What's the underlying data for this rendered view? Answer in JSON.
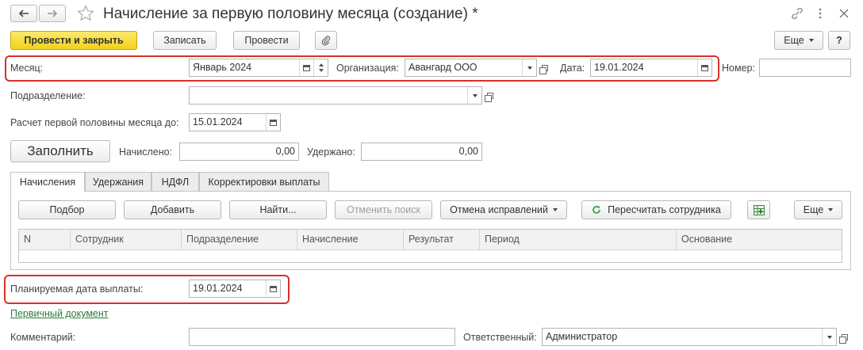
{
  "window": {
    "title": "Начисление за первую половину месяца (создание) *"
  },
  "toolbar": {
    "post_close": "Провести и закрыть",
    "save": "Записать",
    "post": "Провести",
    "more": "Еще",
    "help": "?"
  },
  "header": {
    "month_label": "Месяц:",
    "month_value": "Январь 2024",
    "org_label": "Организация:",
    "org_value": "Авангард ООО",
    "date_label": "Дата:",
    "date_value": "19.01.2024",
    "number_label": "Номер:",
    "number_value": ""
  },
  "division": {
    "label": "Подразделение:",
    "value": ""
  },
  "calc_until": {
    "label": "Расчет первой половины месяца до:",
    "value": "15.01.2024"
  },
  "fill": {
    "button": "Заполнить",
    "accrued_label": "Начислено:",
    "accrued_value": "0,00",
    "withheld_label": "Удержано:",
    "withheld_value": "0,00"
  },
  "tabs": [
    "Начисления",
    "Удержания",
    "НДФЛ",
    "Корректировки выплаты"
  ],
  "table_toolbar": {
    "pick": "Подбор",
    "add": "Добавить",
    "find": "Найти...",
    "cancel_search": "Отменить поиск",
    "cancel_fixes": "Отмена исправлений",
    "recalc": "Пересчитать сотрудника",
    "more": "Еще"
  },
  "table": {
    "columns": [
      "N",
      "Сотрудник",
      "Подразделение",
      "Начисление",
      "Результат",
      "Период",
      "Основание"
    ]
  },
  "payment": {
    "label": "Планируемая дата выплаты:",
    "value": "19.01.2024"
  },
  "primary_doc_link": "Первичный документ",
  "comment": {
    "label": "Комментарий:",
    "value": ""
  },
  "responsible": {
    "label": "Ответственный:",
    "value": "Администратор"
  },
  "colors": {
    "accent_yellow": "#f2d11c",
    "highlight_red": "#d9302b",
    "link_green": "#2f7a3a",
    "refresh_green": "#3aa34a"
  }
}
